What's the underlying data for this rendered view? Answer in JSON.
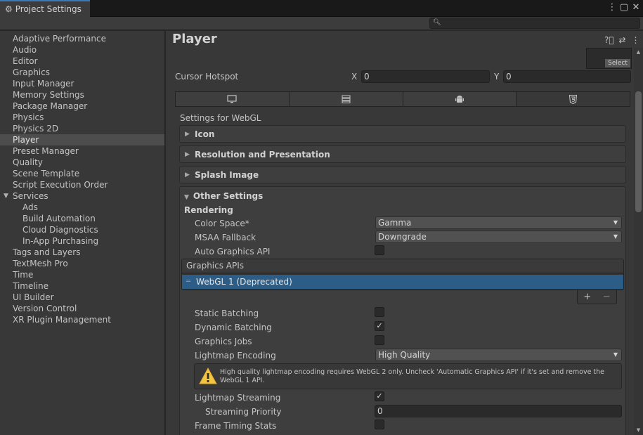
{
  "window": {
    "tab_title": "Project Settings",
    "gear_icon": "gear-icon",
    "controls": [
      "⋮",
      "▢",
      "✕"
    ]
  },
  "search": {
    "placeholder": "",
    "value": ""
  },
  "sidebar": {
    "items": [
      {
        "label": "Adaptive Performance"
      },
      {
        "label": "Audio"
      },
      {
        "label": "Editor"
      },
      {
        "label": "Graphics"
      },
      {
        "label": "Input Manager"
      },
      {
        "label": "Memory Settings"
      },
      {
        "label": "Package Manager"
      },
      {
        "label": "Physics"
      },
      {
        "label": "Physics 2D"
      },
      {
        "label": "Player",
        "selected": true
      },
      {
        "label": "Preset Manager"
      },
      {
        "label": "Quality"
      },
      {
        "label": "Scene Template"
      },
      {
        "label": "Script Execution Order"
      },
      {
        "label": "Services",
        "expanded": true
      },
      {
        "label": "Ads",
        "sub": true
      },
      {
        "label": "Build Automation",
        "sub": true
      },
      {
        "label": "Cloud Diagnostics",
        "sub": true
      },
      {
        "label": "In-App Purchasing",
        "sub": true
      },
      {
        "label": "Tags and Layers"
      },
      {
        "label": "TextMesh Pro"
      },
      {
        "label": "Time"
      },
      {
        "label": "Timeline"
      },
      {
        "label": "UI Builder"
      },
      {
        "label": "Version Control"
      },
      {
        "label": "XR Plugin Management"
      }
    ]
  },
  "main": {
    "title": "Player",
    "select_label": "Select",
    "cursor_hotspot": {
      "label": "Cursor Hotspot",
      "x_label": "X",
      "x_value": "0",
      "y_label": "Y",
      "y_value": "0"
    },
    "platform_tabs": [
      "monitor-icon",
      "server-icon",
      "android-icon",
      "html5-icon"
    ],
    "settings_for": "Settings for WebGL",
    "sections": {
      "icon": "Icon",
      "resolution": "Resolution and Presentation",
      "splash": "Splash Image",
      "other": "Other Settings"
    },
    "rendering": {
      "heading": "Rendering",
      "color_space_label": "Color Space*",
      "color_space_value": "Gamma",
      "msaa_label": "MSAA Fallback",
      "msaa_value": "Downgrade",
      "auto_graphics_label": "Auto Graphics API",
      "auto_graphics_checked": false,
      "graphics_apis_header": "Graphics APIs",
      "graphics_api_item": "WebGL 1 (Deprecated)",
      "plus": "+",
      "minus": "−",
      "static_batching_label": "Static Batching",
      "static_batching_checked": false,
      "dynamic_batching_label": "Dynamic Batching",
      "dynamic_batching_checked": true,
      "graphics_jobs_label": "Graphics Jobs",
      "graphics_jobs_checked": false,
      "lightmap_encoding_label": "Lightmap Encoding",
      "lightmap_encoding_value": "High Quality",
      "warning": "High quality lightmap encoding requires WebGL 2 only. Uncheck 'Automatic Graphics API' if it's set and remove the WebGL 1 API.",
      "lightmap_streaming_label": "Lightmap Streaming",
      "lightmap_streaming_checked": true,
      "streaming_priority_label": "Streaming Priority",
      "streaming_priority_value": "0",
      "frame_timing_label": "Frame Timing Stats",
      "frame_timing_checked": false
    }
  },
  "colors": {
    "selection": "#2c5d87",
    "accent_tab": "#3a79bb",
    "warning": "#f4c542"
  }
}
